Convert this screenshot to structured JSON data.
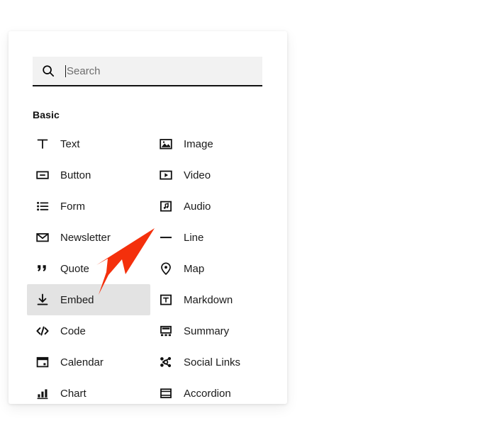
{
  "panel": {
    "name": "block-picker",
    "background": "#ffffff"
  },
  "search": {
    "value": "",
    "placeholder": "Search",
    "icon": "search-icon",
    "focused": true,
    "field_background": "#f2f2f2",
    "underline_color": "#111111"
  },
  "sections": [
    {
      "title": "Basic",
      "columns": 2,
      "items": [
        {
          "label": "Text",
          "icon": "text-icon",
          "column": "left",
          "selected": false
        },
        {
          "label": "Image",
          "icon": "image-icon",
          "column": "right",
          "selected": false
        },
        {
          "label": "Button",
          "icon": "button-icon",
          "column": "left",
          "selected": false
        },
        {
          "label": "Video",
          "icon": "video-icon",
          "column": "right",
          "selected": false
        },
        {
          "label": "Form",
          "icon": "form-icon",
          "column": "left",
          "selected": false
        },
        {
          "label": "Audio",
          "icon": "audio-icon",
          "column": "right",
          "selected": false
        },
        {
          "label": "Newsletter",
          "icon": "newsletter-icon",
          "column": "left",
          "selected": false
        },
        {
          "label": "Line",
          "icon": "line-icon",
          "column": "right",
          "selected": false
        },
        {
          "label": "Quote",
          "icon": "quote-icon",
          "column": "left",
          "selected": false
        },
        {
          "label": "Map",
          "icon": "map-pin-icon",
          "column": "right",
          "selected": false
        },
        {
          "label": "Embed",
          "icon": "embed-icon",
          "column": "left",
          "selected": true
        },
        {
          "label": "Markdown",
          "icon": "markdown-icon",
          "column": "right",
          "selected": false
        },
        {
          "label": "Code",
          "icon": "code-icon",
          "column": "left",
          "selected": false
        },
        {
          "label": "Summary",
          "icon": "summary-icon",
          "column": "right",
          "selected": false
        },
        {
          "label": "Calendar",
          "icon": "calendar-icon",
          "column": "left",
          "selected": false
        },
        {
          "label": "Social Links",
          "icon": "social-links-icon",
          "column": "right",
          "selected": false
        },
        {
          "label": "Chart",
          "icon": "chart-icon",
          "column": "left",
          "selected": false
        },
        {
          "label": "Accordion",
          "icon": "accordion-icon",
          "column": "right",
          "selected": false
        }
      ]
    }
  ],
  "annotation": {
    "type": "arrow",
    "color": "#f4300c",
    "points_to": "Embed",
    "direction": "down-left"
  },
  "selection": {
    "highlight_color": "#e3e3e3",
    "selected_label": "Embed"
  }
}
